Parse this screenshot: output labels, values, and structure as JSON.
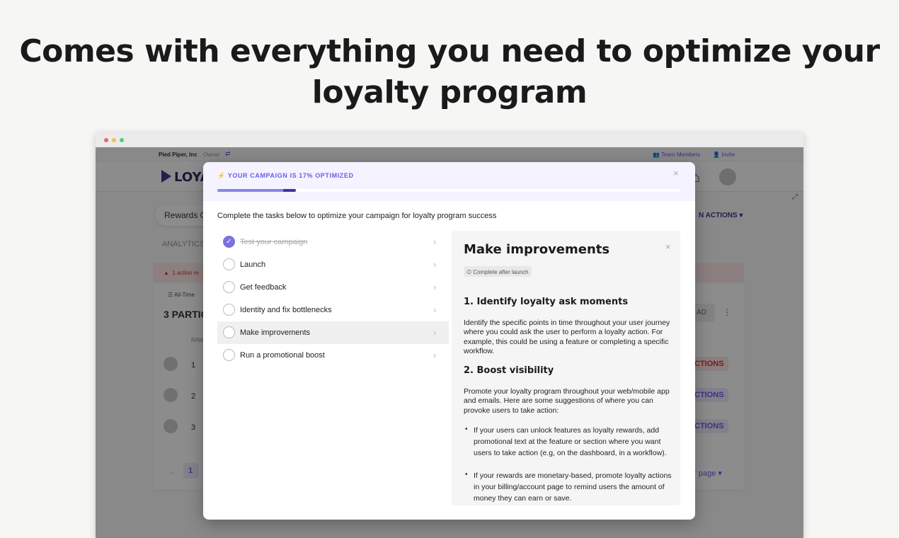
{
  "headline": "Comes with everything you need to optimize your loyalty program",
  "colors": {
    "accent": "#6c5ce7",
    "progress_fill": "#8b84e8",
    "progress_dark": "#3d37a0",
    "alert_text": "#dd3333"
  },
  "window": {
    "traffic_lights": [
      "#f06560",
      "#f6bd4f",
      "#4cd27b"
    ]
  },
  "app": {
    "org": "Pied Piper, Inc",
    "role": "Owner",
    "switch_icon": "swap-icon",
    "team_members": "Team Members",
    "invite": "Invite",
    "logo_text": "LOYA",
    "home_icon": "home-icon",
    "tab_label": "Rewards C",
    "actions_label": "N ACTIONS ▾",
    "analytics_label": "ANALYTICS",
    "alert_text": "1 action re",
    "filter_label": "All-Time",
    "participants_title": "3 PARTIC",
    "download_label": "AD",
    "rank_header": "RAN",
    "rows": [
      {
        "rank": "1",
        "action": "CTIONS"
      },
      {
        "rank": "2",
        "action": "CTIONS"
      },
      {
        "rank": "3",
        "action": "CTIONS"
      }
    ],
    "pager_page": "1",
    "per_page": "er page ▾"
  },
  "modal": {
    "status": "⚡ YOUR CAMPAIGN IS 17% OPTIMIZED",
    "progress": 0.17,
    "close": "×",
    "intro": "Complete the tasks below to optimize your campaign for loyalty program success",
    "tasks": [
      {
        "label": "Test your campaign",
        "done": true
      },
      {
        "label": "Launch",
        "done": false
      },
      {
        "label": "Get feedback",
        "done": false
      },
      {
        "label": "Identity and fix bottlenecks",
        "done": false
      },
      {
        "label": "Make improvements",
        "done": false,
        "active": true
      },
      {
        "label": "Run a promotional boost",
        "done": false
      }
    ],
    "detail": {
      "title": "Make improvements",
      "badge": "Complete after launch",
      "section1_title": "1. Identify loyalty ask moments",
      "section1_text": "Identify the specific points in time throughout your user journey where you could ask the user to perform a loyalty action. For example, this could be using a feature or completing a specific workflow.",
      "section2_title": "2. Boost visibility",
      "section2_text": "Promote your loyalty program throughout your web/mobile app and emails. Here are some suggestions of where you can provoke users to take action:",
      "bullets": [
        "If your users can unlock features as loyalty rewards, add promotional text at the feature or section where you want users to take action (e.g, on the dashboard, in a workflow).",
        "If your rewards are monetary-based, promote loyalty actions in your billing/account page to remind users the amount of money they can earn or save."
      ]
    }
  }
}
